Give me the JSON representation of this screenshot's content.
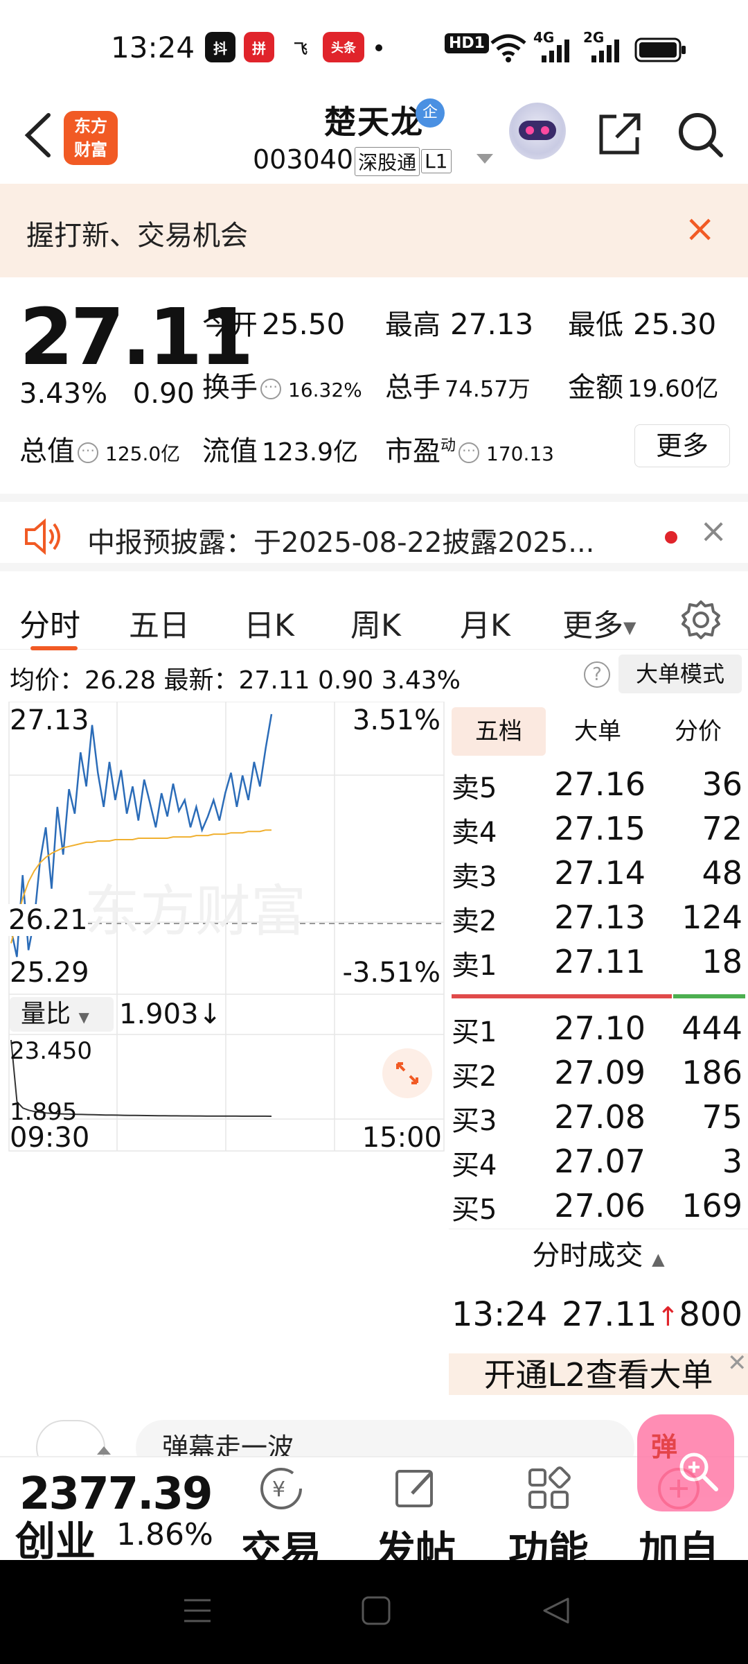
{
  "status_bar": {
    "time": "13:24",
    "apps": [
      "抖",
      "拼",
      "飞",
      "头条"
    ],
    "signal_text": "HD1",
    "net_1": "4G",
    "net_2": "2G"
  },
  "header": {
    "logo_text": "东方\n财富",
    "stock_name": "楚天龙",
    "qi_badge": "企",
    "stock_code": "003040",
    "tag_1": "深股通",
    "tag_2": "L1"
  },
  "banner": {
    "text": "握打新、交易机会",
    "close": "×"
  },
  "quote": {
    "price": "27.11",
    "change_pct": "3.43%",
    "change_val": "0.90",
    "open_label": "今开",
    "open_val": "25.50",
    "high_label": "最高",
    "high_val": "27.13",
    "low_label": "最低",
    "low_val": "25.30",
    "turnover_label": "换手",
    "turnover_val": "16.32%",
    "volume_label": "总手",
    "volume_val": "74.57万",
    "amount_label": "金额",
    "amount_val": "19.60亿",
    "mktcap_label": "总值",
    "mktcap_val": "125.0亿",
    "float_label": "流值",
    "float_val": "123.9亿",
    "pe_label": "市盈",
    "pe_sup": "动",
    "pe_val": "170.13",
    "more_button": "更多"
  },
  "notice": {
    "text": "中报预披露：于2025-08-22披露2025...",
    "close": "×"
  },
  "tabs": {
    "items": [
      "分时",
      "五日",
      "日K",
      "周K",
      "月K",
      "更多"
    ],
    "active": "分时"
  },
  "avg_line": {
    "text": "均价：26.28 最新：27.11  0.90  3.43%",
    "help": "?",
    "big_mode": "大单模式"
  },
  "chart_labels": {
    "price_top": "27.13",
    "price_mid": "26.21",
    "price_bottom": "25.29",
    "pct_top": "3.51%",
    "pct_bottom": "-3.51%",
    "volratio_label": "量比",
    "volratio_val": "1.903↓",
    "vr_top": "23.450",
    "vr_bottom": "1.895",
    "time_start": "09:30",
    "time_end": "15:00",
    "watermark": "东方财富"
  },
  "chart_data": {
    "type": "line",
    "title": "",
    "ylim": [
      25.29,
      27.13
    ],
    "series": [
      {
        "values": [
          25.55,
          25.35,
          25.95,
          25.4,
          25.62,
          26.05,
          26.3,
          25.85,
          26.45,
          26.1,
          26.58,
          26.4,
          26.85,
          26.6,
          27.05,
          26.7,
          26.45,
          26.78,
          26.5,
          26.72,
          26.4,
          26.6,
          26.35,
          26.65,
          26.48,
          26.3,
          26.55,
          26.38,
          26.62,
          26.42,
          26.5,
          26.3,
          26.45,
          26.28,
          26.38,
          26.5,
          26.35,
          26.55,
          26.7,
          26.45,
          26.68,
          26.5,
          26.78,
          26.6,
          26.88,
          27.13
        ]
      },
      {
        "values": [
          25.45,
          25.62,
          25.78,
          25.9,
          25.98,
          26.04,
          26.08,
          26.11,
          26.13,
          26.15,
          26.16,
          26.17,
          26.18,
          26.19,
          26.19,
          26.2,
          26.2,
          26.2,
          26.21,
          26.21,
          26.21,
          26.21,
          26.22,
          26.22,
          26.22,
          26.22,
          26.22,
          26.22,
          26.23,
          26.23,
          26.23,
          26.23,
          26.24,
          26.24,
          26.24,
          26.25,
          26.25,
          26.25,
          26.26,
          26.26,
          26.26,
          26.27,
          26.27,
          26.27,
          26.28,
          26.28
        ]
      }
    ],
    "volume_ratio": {
      "ylim": [
        1.895,
        23.45
      ],
      "values": [
        23.45,
        6.0,
        4.2,
        3.6,
        3.2,
        3.0,
        2.8,
        2.7,
        2.6,
        2.55,
        2.5,
        2.45,
        2.4,
        2.36,
        2.32,
        2.28,
        2.25,
        2.22,
        2.2,
        2.17,
        2.15,
        2.13,
        2.11,
        2.09,
        2.07,
        2.05,
        2.04,
        2.02,
        2.01,
        2.0,
        1.99,
        1.98,
        1.97,
        1.96,
        1.95,
        1.94,
        1.935,
        1.93,
        1.925,
        1.92,
        1.915,
        1.91,
        1.907,
        1.905,
        1.903
      ]
    },
    "xlabel": "",
    "ylabel": "",
    "colors": {
      "price": "#2b6cb8",
      "avg": "#f0b030"
    }
  },
  "order_book": {
    "tabs": [
      "五档",
      "大单",
      "分价"
    ],
    "asks": [
      {
        "label": "卖5",
        "price": "27.16",
        "qty": "36"
      },
      {
        "label": "卖4",
        "price": "27.15",
        "qty": "72"
      },
      {
        "label": "卖3",
        "price": "27.14",
        "qty": "48"
      },
      {
        "label": "卖2",
        "price": "27.13",
        "qty": "124"
      },
      {
        "label": "卖1",
        "price": "27.11",
        "qty": "18"
      }
    ],
    "bids": [
      {
        "label": "买1",
        "price": "27.10",
        "qty": "444"
      },
      {
        "label": "买2",
        "price": "27.09",
        "qty": "186"
      },
      {
        "label": "买3",
        "price": "27.08",
        "qty": "75"
      },
      {
        "label": "买4",
        "price": "27.07",
        "qty": "3"
      },
      {
        "label": "买5",
        "price": "27.06",
        "qty": "169"
      }
    ],
    "ticks_title": "分时成交",
    "tick_time": "13:24",
    "tick_price": "27.11",
    "tick_arrow": "↑",
    "tick_qty": "800",
    "l2_banner": "开通L2查看大单"
  },
  "bottom": {
    "comment_placeholder": "弹幕走一波",
    "index_value": "2377.39",
    "index_name": "创业",
    "index_pct": "1.86%",
    "tool_trade": "交易",
    "tool_post": "发帖",
    "tool_func": "功能",
    "tool_add": "加自",
    "float_text": "弹"
  },
  "colors": {
    "accent": "#f15a24",
    "price_line": "#2b6cb8",
    "avg_line": "#f0b030",
    "ask_bar": "#e04a4a",
    "bid_bar": "#4caf50"
  }
}
